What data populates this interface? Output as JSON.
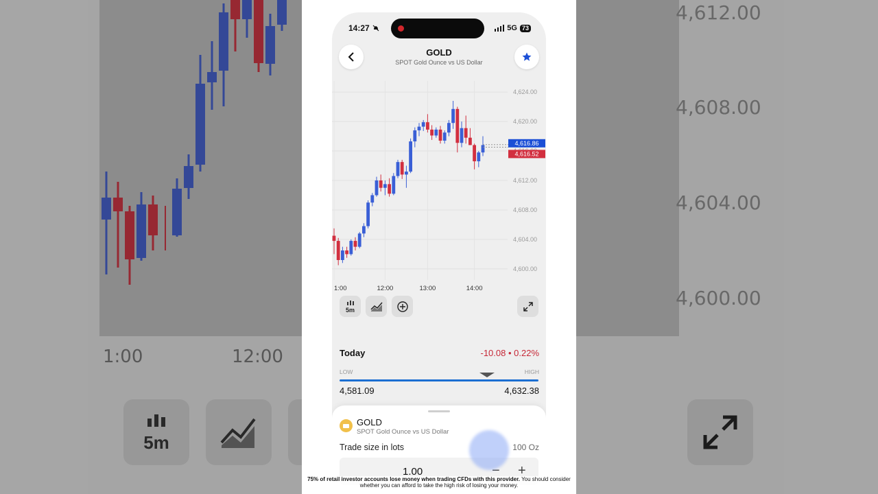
{
  "background": {
    "price_labels": [
      "4,612.00",
      "4,608.00",
      "4,604.00",
      "4,600.00"
    ],
    "time_labels": [
      "1:00",
      "12:00"
    ],
    "interval_label": "5m"
  },
  "status_bar": {
    "time": "14:27",
    "network": "5G",
    "battery": "73"
  },
  "header": {
    "symbol": "GOLD",
    "description": "SPOT Gold Ounce vs US Dollar"
  },
  "colors": {
    "up": "#3a5fd6",
    "down": "#d22f3f",
    "accent": "#1b6fd2",
    "negative": "#c62837"
  },
  "chart_data": {
    "type": "candlestick",
    "y_ticks": [
      "4,624.00",
      "4,620.00",
      "4,616.00",
      "4,612.00",
      "4,608.00",
      "4,604.00",
      "4,600.00"
    ],
    "x_ticks": [
      "1:00",
      "12:00",
      "13:00",
      "14:00"
    ],
    "ylim": [
      4598.5,
      4625.5
    ],
    "ask_label": "4,616.86",
    "bid_label": "4,616.52",
    "ask": 4616.86,
    "bid": 4616.52,
    "candles": [
      [
        4604.5,
        4605.5,
        4602.0,
        4603.8
      ],
      [
        4603.8,
        4604.2,
        4600.5,
        4601.2
      ],
      [
        4601.2,
        4603.0,
        4600.8,
        4602.5
      ],
      [
        4602.5,
        4603.0,
        4601.5,
        4602.0
      ],
      [
        4602.0,
        4604.0,
        4601.8,
        4603.8
      ],
      [
        4603.8,
        4604.3,
        4602.5,
        4603.0
      ],
      [
        4603.0,
        4605.0,
        4602.8,
        4604.8
      ],
      [
        4604.8,
        4606.2,
        4604.3,
        4605.8
      ],
      [
        4605.8,
        4609.3,
        4605.5,
        4609.0
      ],
      [
        4609.0,
        4610.3,
        4608.5,
        4610.0
      ],
      [
        4610.0,
        4612.5,
        4609.8,
        4612.0
      ],
      [
        4612.0,
        4612.8,
        4610.5,
        4611.0
      ],
      [
        4611.0,
        4612.0,
        4610.0,
        4611.5
      ],
      [
        4611.5,
        4612.3,
        4609.8,
        4610.2
      ],
      [
        4610.2,
        4613.0,
        4610.0,
        4612.6
      ],
      [
        4612.6,
        4614.8,
        4612.3,
        4614.5
      ],
      [
        4614.5,
        4614.8,
        4612.2,
        4612.8
      ],
      [
        4612.8,
        4614.0,
        4611.0,
        4613.2
      ],
      [
        4613.2,
        4617.7,
        4613.0,
        4617.3
      ],
      [
        4617.3,
        4619.2,
        4616.5,
        4618.8
      ],
      [
        4618.8,
        4619.8,
        4618.0,
        4619.3
      ],
      [
        4619.3,
        4620.2,
        4618.7,
        4619.9
      ],
      [
        4619.9,
        4621.0,
        4618.5,
        4618.9
      ],
      [
        4618.9,
        4619.5,
        4617.5,
        4618.1
      ],
      [
        4618.1,
        4619.2,
        4617.8,
        4618.9
      ],
      [
        4618.9,
        4619.4,
        4617.0,
        4617.4
      ],
      [
        4617.4,
        4618.8,
        4617.0,
        4618.5
      ],
      [
        4618.5,
        4620.2,
        4618.0,
        4619.8
      ],
      [
        4619.8,
        4622.8,
        4619.0,
        4621.7
      ],
      [
        4621.7,
        4622.0,
        4615.8,
        4617.1
      ],
      [
        4617.1,
        4620.0,
        4616.5,
        4619.1
      ],
      [
        4619.1,
        4620.8,
        4617.0,
        4617.8
      ],
      [
        4617.8,
        4619.1,
        4616.8,
        4616.8
      ],
      [
        4616.8,
        4617.0,
        4613.5,
        4614.6
      ],
      [
        4614.6,
        4616.0,
        4613.8,
        4615.8
      ],
      [
        4615.8,
        4618.0,
        4615.3,
        4616.8
      ]
    ]
  },
  "toolbar": {
    "interval": "5m",
    "candles_icon": "candlestick-icon",
    "chart_type_icon": "area-chart-icon",
    "add_icon": "plus-circle-icon",
    "expand_icon": "expand-icon"
  },
  "today": {
    "label": "Today",
    "change": "-10.08 • 0.22%",
    "low_label": "LOW",
    "high_label": "HIGH",
    "low_value": "4,581.09",
    "high_value": "4,632.38",
    "current_position": 0.74
  },
  "trade_sheet": {
    "asset": "GOLD",
    "asset_description": "SPOT Gold Ounce vs US Dollar",
    "trade_size_label": "Trade size in lots",
    "unit": "100 Oz",
    "quantity": "1.00",
    "minus": "−",
    "plus": "+"
  },
  "disclaimer": {
    "bold": "75% of retail investor accounts lose money when trading CFDs with this provider.",
    "rest": "You should consider whether you can afford to take the high risk of losing your money."
  }
}
